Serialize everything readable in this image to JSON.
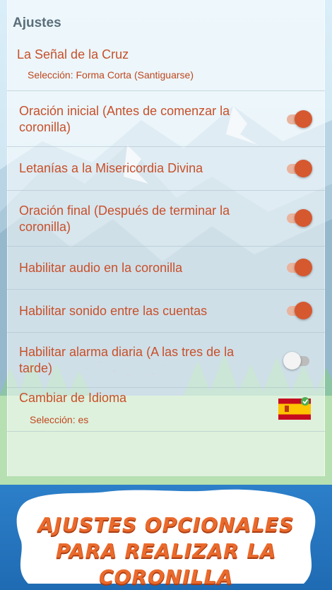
{
  "header": {
    "title": "Ajustes"
  },
  "items": [
    {
      "title": "La Señal de la Cruz",
      "subtitle": "Selección: Forma Corta (Santiguarse)"
    },
    {
      "title": "Oración inicial (Antes de comenzar la coronilla)",
      "toggle": "on"
    },
    {
      "title": "Letanías a la Misericordia Divina",
      "toggle": "on"
    },
    {
      "title": "Oración final (Después de terminar la coronilla)",
      "toggle": "on"
    },
    {
      "title": "Habilitar audio en la coronilla",
      "toggle": "on"
    },
    {
      "title": "Habilitar sonido entre las cuentas",
      "toggle": "on"
    },
    {
      "title": "Habilitar alarma diaria (A las tres de la tarde)",
      "toggle": "off"
    },
    {
      "title": "Cambiar de Idioma",
      "subtitle": "Selección: es",
      "icon": "spain-flag-icon"
    }
  ],
  "banner": {
    "line1": "AJUSTES OPCIONALES",
    "line2": "PARA REALIZAR LA",
    "line3": "CORONILLA"
  },
  "colors": {
    "accent": "#d6582f",
    "text_accent": "#c8502a",
    "banner_blue": "#1f6bb3",
    "header_gray": "#5a6e7a"
  }
}
